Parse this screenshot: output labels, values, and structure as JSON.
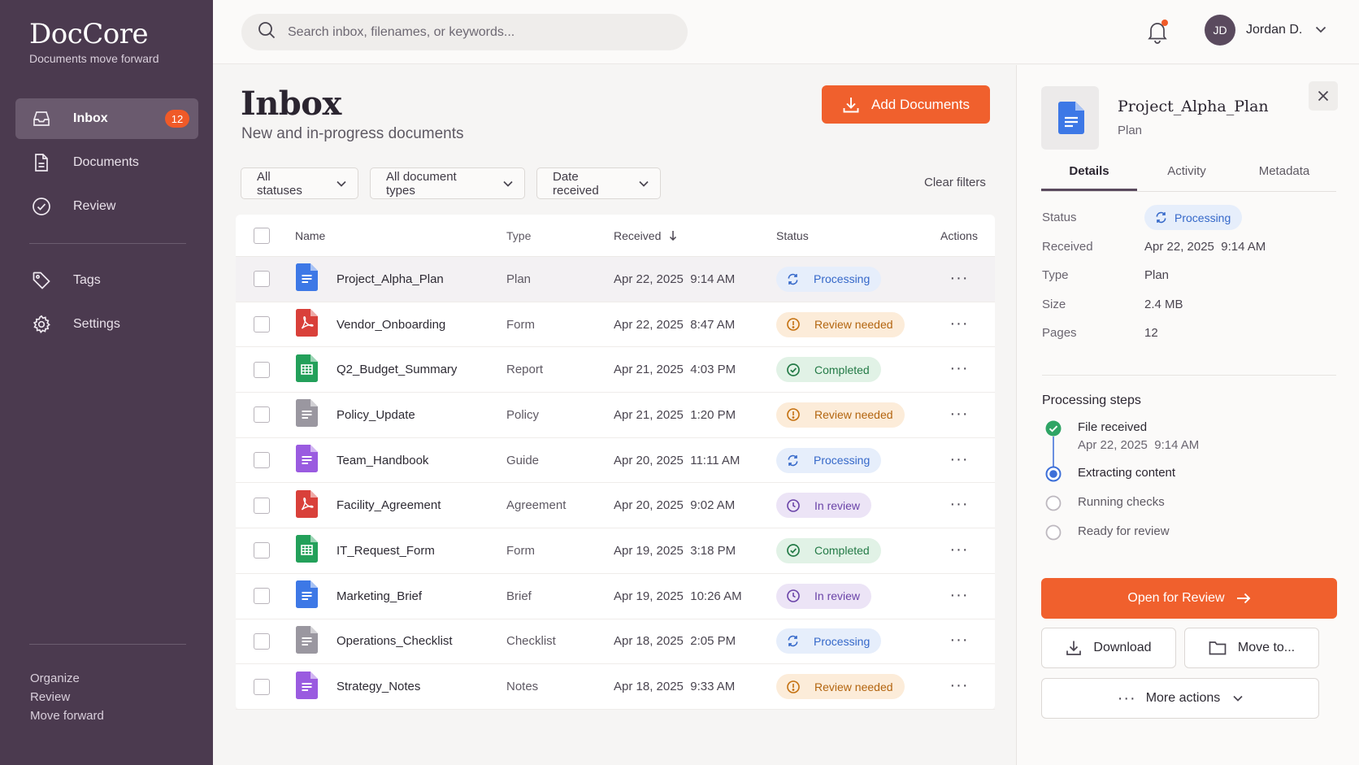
{
  "brand": {
    "name": "DocCore",
    "tagline": "Documents move forward"
  },
  "sidebar": {
    "items": [
      {
        "label": "Inbox",
        "icon": "inbox-icon",
        "badge": "12",
        "active": true
      },
      {
        "label": "Documents",
        "icon": "document-icon"
      },
      {
        "label": "Review",
        "icon": "check-circle-icon"
      },
      {
        "label": "Tags",
        "icon": "tag-icon"
      },
      {
        "label": "Settings",
        "icon": "gear-icon"
      }
    ],
    "footer": [
      "Organize",
      "Review",
      "Move forward"
    ]
  },
  "topbar": {
    "search_placeholder": "Search inbox, filenames, or keywords...",
    "user_initials": "JD",
    "user_name": "Jordan D."
  },
  "main": {
    "title": "Inbox",
    "subtitle": "New and in-progress documents",
    "add_button": "Add Documents",
    "filters": [
      "All statuses",
      "All document types",
      "Date received"
    ],
    "clear_filters": "Clear filters"
  },
  "table": {
    "headers": {
      "name": "Name",
      "type": "Type",
      "received": "Received",
      "status": "Status",
      "actions": "Actions"
    },
    "rows": [
      {
        "name": "Project_Alpha_Plan",
        "kind": "doc",
        "type": "Plan",
        "received": "Apr 22, 2025  9:14 AM",
        "status": "Processing"
      },
      {
        "name": "Vendor_Onboarding",
        "kind": "pdf",
        "type": "Form",
        "received": "Apr 22, 2025  8:47 AM",
        "status": "Review needed"
      },
      {
        "name": "Q2_Budget_Summary",
        "kind": "sheet",
        "type": "Report",
        "received": "Apr 21, 2025  4:03 PM",
        "status": "Completed"
      },
      {
        "name": "Policy_Update",
        "kind": "gray",
        "type": "Policy",
        "received": "Apr 21, 2025  1:20 PM",
        "status": "Review needed"
      },
      {
        "name": "Team_Handbook",
        "kind": "purple",
        "type": "Guide",
        "received": "Apr 20, 2025  11:11 AM",
        "status": "Processing"
      },
      {
        "name": "Facility_Agreement",
        "kind": "pdf",
        "type": "Agreement",
        "received": "Apr 20, 2025  9:02 AM",
        "status": "In review"
      },
      {
        "name": "IT_Request_Form",
        "kind": "sheet",
        "type": "Form",
        "received": "Apr 19, 2025  3:18 PM",
        "status": "Completed"
      },
      {
        "name": "Marketing_Brief",
        "kind": "doc",
        "type": "Brief",
        "received": "Apr 19, 2025  10:26 AM",
        "status": "In review"
      },
      {
        "name": "Operations_Checklist",
        "kind": "gray",
        "type": "Checklist",
        "received": "Apr 18, 2025  2:05 PM",
        "status": "Processing"
      },
      {
        "name": "Strategy_Notes",
        "kind": "purple",
        "type": "Notes",
        "received": "Apr 18, 2025  9:33 AM",
        "status": "Review needed"
      }
    ]
  },
  "panel": {
    "title": "Project_Alpha_Plan",
    "subtitle": "Plan",
    "tabs": [
      "Details",
      "Activity",
      "Metadata"
    ],
    "details": {
      "status_label": "Status",
      "status_value": "Processing",
      "received_label": "Received",
      "received_value": "Apr 22, 2025  9:14 AM",
      "type_label": "Type",
      "type_value": "Plan",
      "size_label": "Size",
      "size_value": "2.4 MB",
      "pages_label": "Pages",
      "pages_value": "12"
    },
    "steps_title": "Processing steps",
    "steps": [
      {
        "label": "File received",
        "sub": "Apr 22, 2025  9:14 AM",
        "state": "done"
      },
      {
        "label": "Extracting content",
        "sub": "",
        "state": "current"
      },
      {
        "label": "Running checks",
        "sub": "",
        "state": "pending"
      },
      {
        "label": "Ready for review",
        "sub": "",
        "state": "pending"
      }
    ],
    "open_button": "Open for Review",
    "download_button": "Download",
    "move_button": "Move to...",
    "more_button": "More actions"
  },
  "colors": {
    "sidebar": "#4b3a4f",
    "accent": "#f0602d",
    "processing": "#3568c9",
    "review_needed": "#b3650f",
    "completed": "#237a46",
    "in_review": "#6a43a8"
  }
}
